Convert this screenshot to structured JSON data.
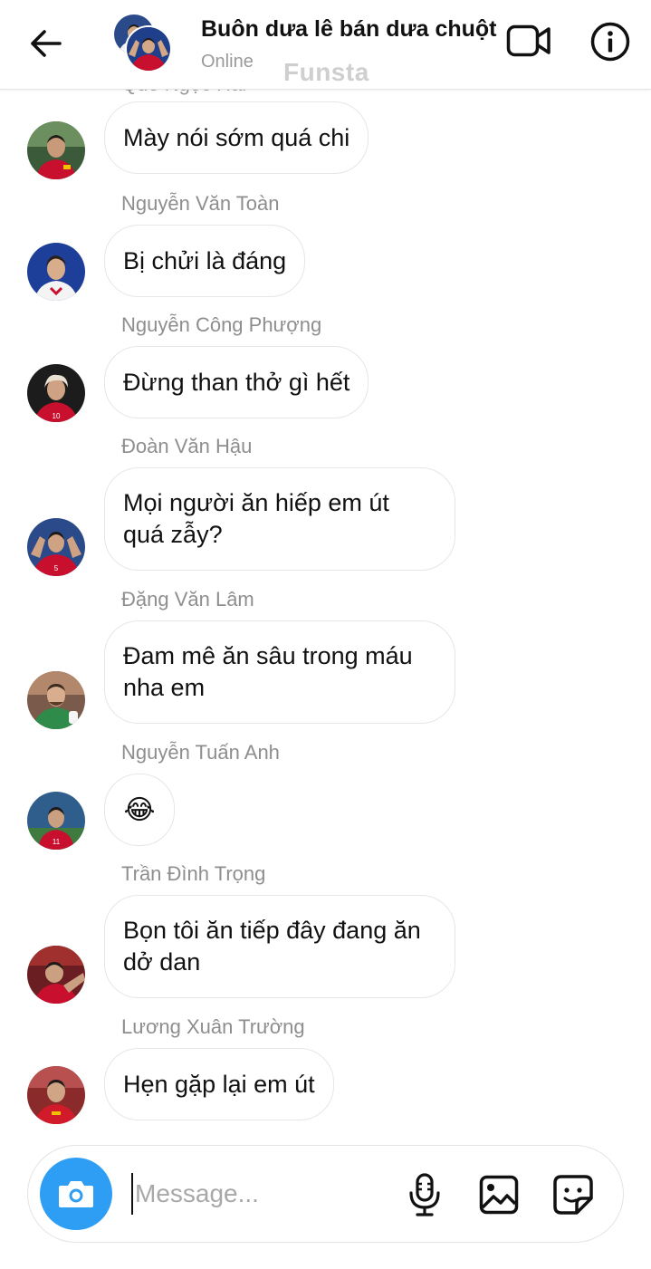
{
  "header": {
    "title": "Buôn dưa lê bán dưa chuột",
    "status": "Online",
    "watermark": "Funsta"
  },
  "cut_sender": "Quế Ngọc Hải",
  "messages": [
    {
      "sender": "",
      "text": "Mày nói sớm quá chi",
      "jersey": ""
    },
    {
      "sender": "Nguyễn Văn Toàn",
      "text": "Bị chửi là đáng",
      "jersey": ""
    },
    {
      "sender": "Nguyễn Công Phượng",
      "text": "Đừng than thở gì hết",
      "jersey": "10"
    },
    {
      "sender": "Đoàn Văn Hậu",
      "text": "Mọi người ăn hiếp em út quá zẫy?",
      "jersey": "5"
    },
    {
      "sender": "Đặng Văn Lâm",
      "text": "Đam mê ăn sâu trong máu nha em",
      "jersey": ""
    },
    {
      "sender": "Nguyễn Tuấn Anh",
      "text": "😂",
      "jersey": "11"
    },
    {
      "sender": "Trần Đình Trọng",
      "text": "Bọn tôi ăn tiếp đây đang ăn dở dan",
      "jersey": ""
    },
    {
      "sender": "Lương Xuân Trường",
      "text": "Hẹn gặp lại em út",
      "jersey": ""
    }
  ],
  "composer": {
    "placeholder": "Message..."
  },
  "colors": {
    "accent": "#2e9ef5",
    "bubble_border": "#e6e6e6",
    "sender_text": "#8e8e8e",
    "jersey_red": "#c8102e"
  },
  "icons": {
    "back": "arrow-left-icon",
    "video": "video-camera-icon",
    "info": "info-icon",
    "camera": "camera-icon",
    "mic": "microphone-icon",
    "gallery": "image-icon",
    "sticker": "sticker-icon"
  }
}
